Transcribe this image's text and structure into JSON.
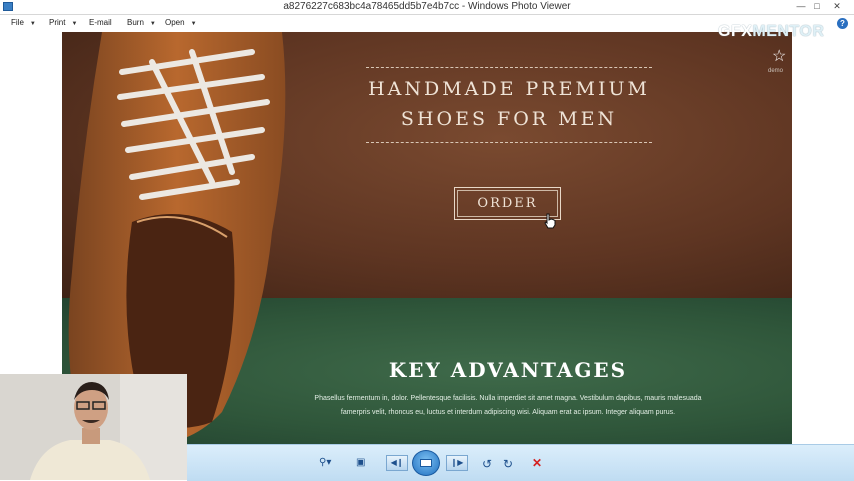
{
  "window": {
    "title": "a8276227c683bc4a78465dd5b7e4b7cc - Windows Photo Viewer"
  },
  "menu": {
    "file": "File",
    "print": "Print",
    "email": "E-mail",
    "burn": "Burn",
    "open": "Open"
  },
  "watermark": {
    "gfx": "GFX",
    "mentor": "MENTOR"
  },
  "photo": {
    "headline_line1": "HANDMADE PREMIUM",
    "headline_line2": "SHOES FOR MEN",
    "order_label": "ORDER",
    "demo_label": "demo",
    "advantages_title": "KEY ADVANTAGES",
    "advantages_line1": "Phasellus fermentum in, dolor. Pellentesque facilisis. Nulla imperdiet sit amet magna. Vestibulum dapibus, mauris malesuada",
    "advantages_line2": "famerpris velit, rhoncus eu, luctus et interdum adipiscing wisi. Aliquam erat ac ipsum. Integer aliquam purus."
  },
  "colors": {
    "hero_brown": "#5e3522",
    "section_green": "#2f563a",
    "toolbar_blue": "#cbe4f6",
    "delete_red": "#d42020"
  },
  "icons": {
    "app": "photo-viewer-icon",
    "zoom": "magnifier-icon",
    "fit": "actual-size-icon",
    "prev": "previous-icon",
    "slideshow": "slideshow-icon",
    "next": "next-icon",
    "rotate_ccw": "rotate-counterclockwise-icon",
    "rotate_cw": "rotate-clockwise-icon",
    "delete": "delete-icon"
  }
}
